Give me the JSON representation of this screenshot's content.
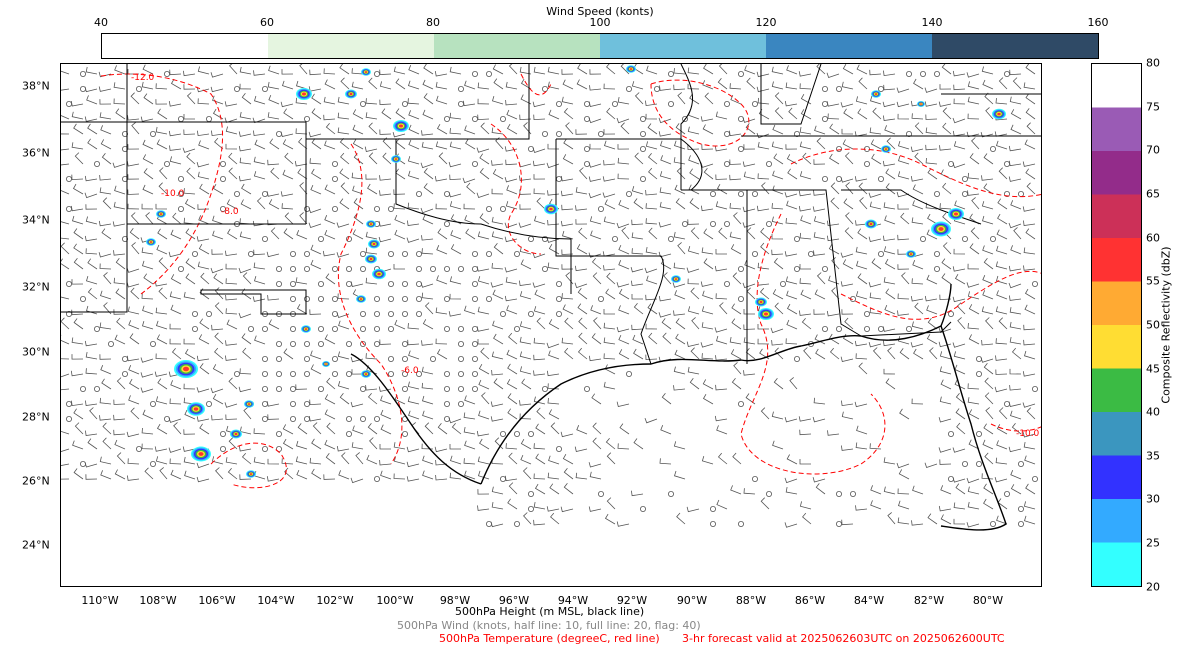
{
  "wind_colorbar": {
    "title": "Wind Speed (konts)",
    "ticks": [
      "40",
      "60",
      "80",
      "100",
      "120",
      "140",
      "160"
    ],
    "colors": [
      "#ffffff",
      "#e5f5e0",
      "#b7e2bf",
      "#6fc0dc",
      "#3a86c0",
      "#2f4a66"
    ]
  },
  "map": {
    "lat_labels": [
      "38°N",
      "36°N",
      "34°N",
      "32°N",
      "30°N",
      "28°N",
      "26°N",
      "24°N"
    ],
    "lon_labels": [
      "110°W",
      "108°W",
      "106°W",
      "104°W",
      "102°W",
      "100°W",
      "98°W",
      "96°W",
      "94°W",
      "92°W",
      "90°W",
      "88°W",
      "86°W",
      "84°W",
      "82°W",
      "80°W"
    ],
    "temperature_contour_labels": [
      "-12.0",
      "-10.0",
      "-8.0",
      "-6.0",
      "-10.0"
    ],
    "colors": {
      "height_contour": "#000000",
      "temperature_contour": "#ff0000",
      "wind_barb": "#555555",
      "coastline": "#000000"
    }
  },
  "reflectivity_colorbar": {
    "title": "Composite Reflectivity (dbZ)",
    "ticks": [
      "80",
      "75",
      "70",
      "65",
      "60",
      "55",
      "50",
      "45",
      "40",
      "35",
      "30",
      "25",
      "20"
    ],
    "colors": [
      "#ffffff",
      "#9a5bb5",
      "#932c8a",
      "#cc3058",
      "#ff3232",
      "#ffaa33",
      "#ffdd33",
      "#3bbb44",
      "#3b96bf",
      "#3232ff",
      "#33aaff",
      "#33ffff"
    ]
  },
  "captions": {
    "height": "500hPa Height (m MSL, black line)",
    "wind": "500hPa Wind (knots, half line: 10, full line: 20, flag: 40)",
    "temperature": "500hPa Temperature (degreeC, red line)",
    "valid": "3-hr forecast valid at 2025062603UTC on 2025062600UTC"
  }
}
